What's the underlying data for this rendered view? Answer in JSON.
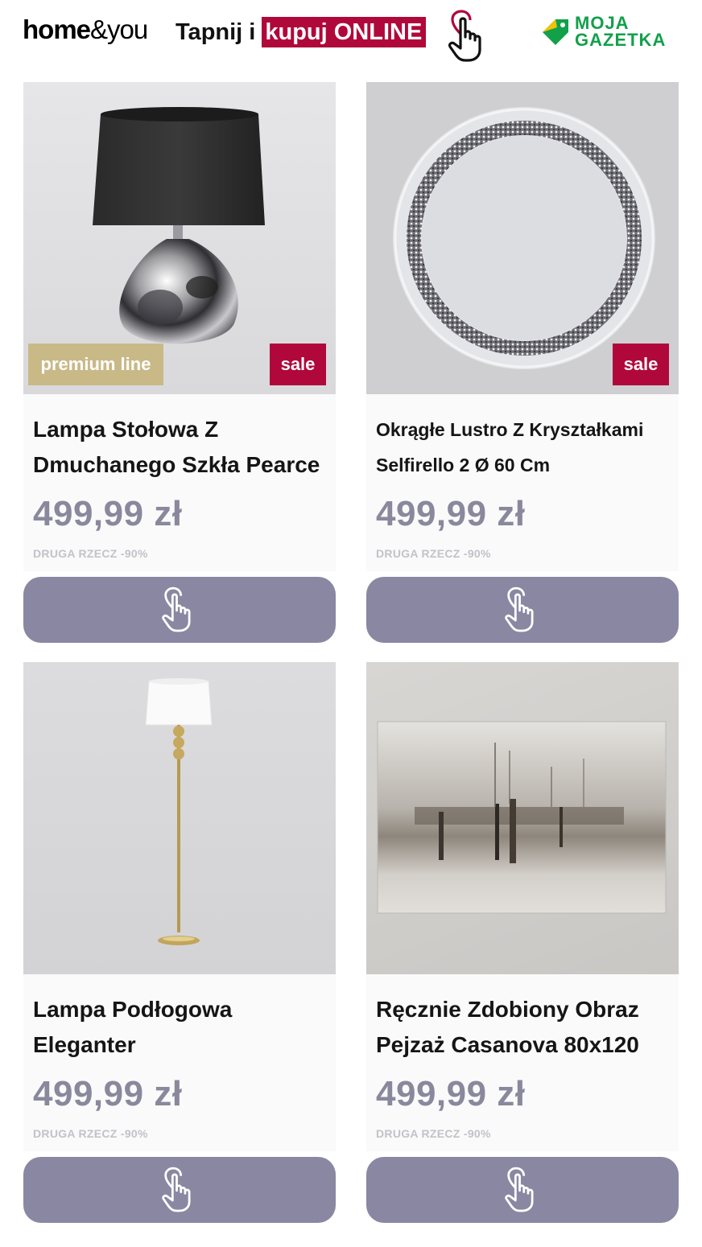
{
  "header": {
    "brand_bold": "home",
    "brand_light": "&you",
    "tagline_plain": "Tapnij i",
    "tagline_highlight": "kupuj ONLINE",
    "partner_line1": "MOJA",
    "partner_line2": "GAZETKA"
  },
  "colors": {
    "accent": "#b0083a",
    "price": "#8a889c",
    "button": "#8a87a2",
    "premium": "#c9b987",
    "partner": "#12a04b"
  },
  "products": [
    {
      "title": "Lampa Stołowa Z Dmuchanego Szkła Pearce",
      "price": "499,99 zł",
      "note": "DRUGA RZECZ -90%",
      "badge_sale": "sale",
      "badge_premium": "premium line",
      "image": "table-lamp",
      "button_icon": "tap-hand-icon"
    },
    {
      "title": "Okrągłe Lustro Z Kryształkami Selfirello 2 Ø 60 Cm",
      "price": "499,99 zł",
      "note": "DRUGA RZECZ -90%",
      "badge_sale": "sale",
      "image": "round-mirror",
      "button_icon": "tap-hand-icon"
    },
    {
      "title": "Lampa Podłogowa Eleganter",
      "price": "499,99 zł",
      "note": "DRUGA RZECZ -90%",
      "image": "floor-lamp",
      "button_icon": "tap-hand-icon"
    },
    {
      "title": "Ręcznie Zdobiony Obraz Pejzaż Casanova 80x120",
      "price": "499,99 zł",
      "note": "DRUGA RZECZ -90%",
      "image": "abstract-painting",
      "button_icon": "tap-hand-icon"
    }
  ]
}
